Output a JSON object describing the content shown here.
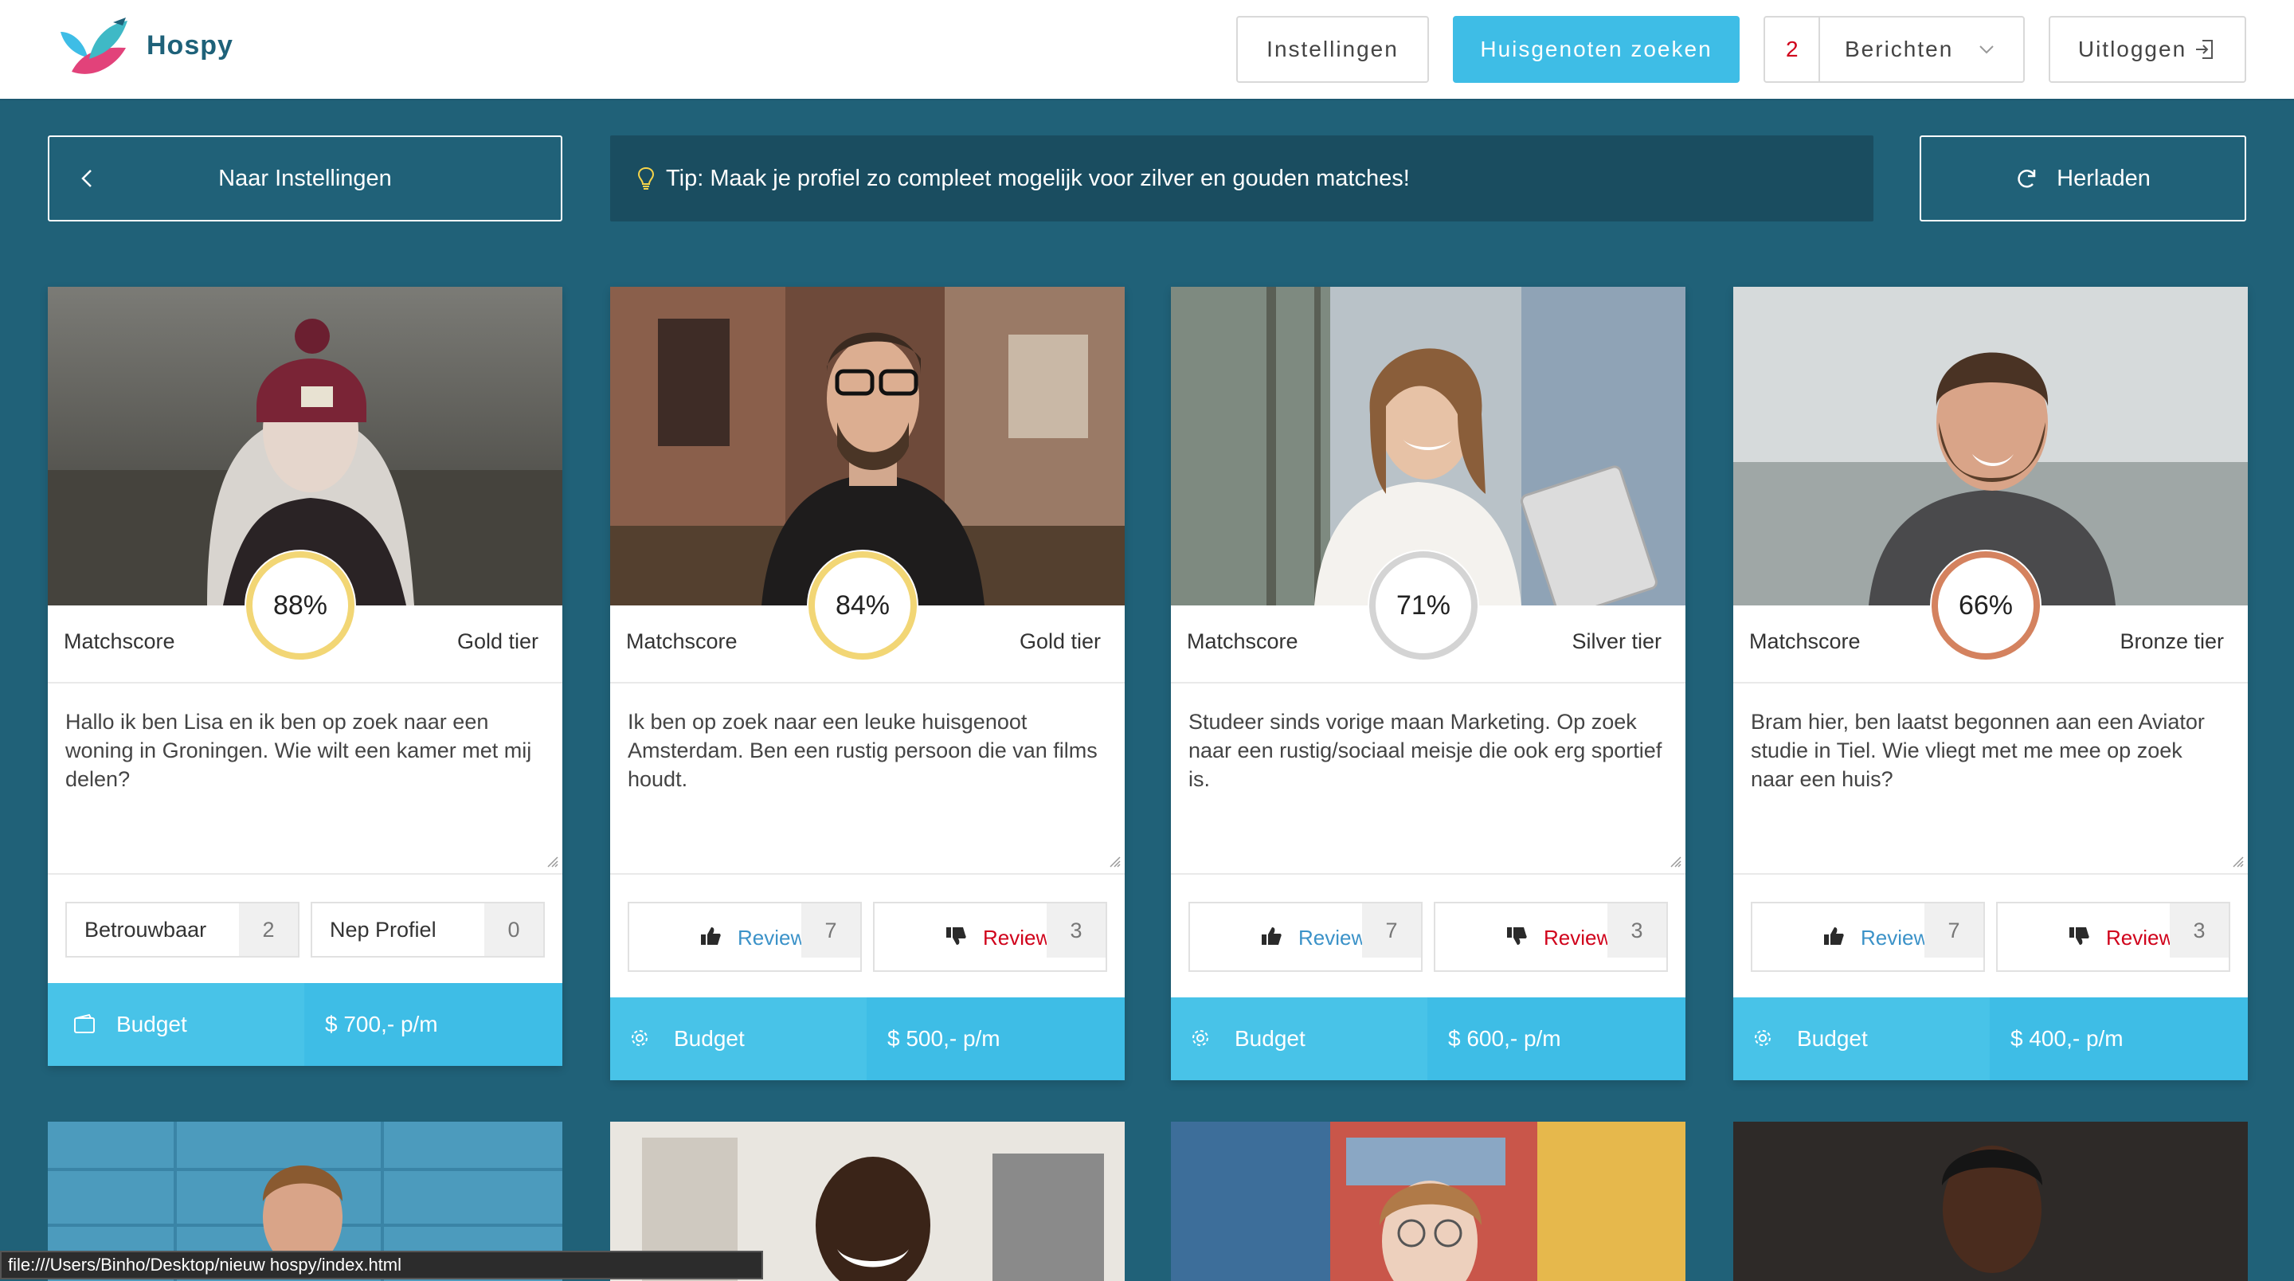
{
  "app": {
    "name": "Hospy"
  },
  "header": {
    "settings_label": "Instellingen",
    "search_label": "Huisgenoten zoeken",
    "messages_count": "2",
    "messages_label": "Berichten",
    "logout_label": "Uitloggen"
  },
  "actionbar": {
    "back_label": "Naar Instellingen",
    "tip": "Tip: Maak je profiel zo compleet mogelijk voor zilver en gouden matches!",
    "reload_label": "Herladen"
  },
  "cards": [
    {
      "score": "88%",
      "score_value": 88,
      "matchscore_label": "Matchscore",
      "tier": "Gold tier",
      "ring_color": "#f2d675",
      "description": "Hallo ik ben Lisa en ik ben op zoek naar een woning in Groningen. Wie wilt een kamer met mij delen?",
      "trust_label": "Betrouwbaar",
      "trust_count": "2",
      "fake_label": "Nep Profiel",
      "fake_count": "0",
      "budget_label": "Budget",
      "budget_value": "$ 700,- p/m"
    },
    {
      "score": "84%",
      "score_value": 84,
      "matchscore_label": "Matchscore",
      "tier": "Gold tier",
      "ring_color": "#f2d675",
      "description": "Ik ben op zoek naar een leuke huisgenoot Amsterdam. Ben een rustig persoon die van films houdt.",
      "review_up_label": "Review",
      "review_up_count": "7",
      "review_down_label": "Review",
      "review_down_count": "3",
      "budget_label": "Budget",
      "budget_value": "$ 500,- p/m"
    },
    {
      "score": "71%",
      "score_value": 71,
      "matchscore_label": "Matchscore",
      "tier": "Silver tier",
      "ring_color": "#d4d4d4",
      "description": "Studeer sinds vorige maan Marketing. Op zoek naar een rustig/sociaal meisje die ook erg sportief is.",
      "review_up_label": "Review",
      "review_up_count": "7",
      "review_down_label": "Review",
      "review_down_count": "3",
      "budget_label": "Budget",
      "budget_value": "$ 600,- p/m"
    },
    {
      "score": "66%",
      "score_value": 66,
      "matchscore_label": "Matchscore",
      "tier": "Bronze tier",
      "ring_color": "#d4825f",
      "description": "Bram hier, ben laatst begonnen aan een Aviator studie in Tiel. Wie vliegt met me mee op zoek naar een huis?",
      "review_up_label": "Review",
      "review_up_count": "7",
      "review_down_label": "Review",
      "review_down_count": "3",
      "budget_label": "Budget",
      "budget_value": "$ 400,- p/m"
    }
  ],
  "statusbar": {
    "url": "file:///Users/Binho/Desktop/nieuw hospy/index.html"
  },
  "colors": {
    "header_bg": "#ffffff",
    "page_bg": "#206178",
    "accent": "#3ebde6",
    "tip_bg": "#1a4d60",
    "danger": "#d0021b"
  }
}
